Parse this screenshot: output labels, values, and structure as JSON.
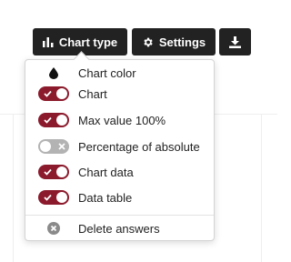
{
  "toolbar": {
    "chart_type_label": "Chart type",
    "chart_type_icon": "bar-chart-icon",
    "settings_label": "Settings",
    "settings_icon": "gear-icon",
    "download_icon": "download-icon",
    "button_color": "#222222"
  },
  "menu": {
    "items": [
      {
        "label": "Chart color",
        "icon": "color-drop-icon"
      },
      {
        "label": "Chart",
        "toggle": "on"
      },
      {
        "label": "Max value 100%",
        "toggle": "on"
      },
      {
        "label": "Percentage of absolute",
        "toggle": "off"
      },
      {
        "label": "Chart data",
        "toggle": "on"
      },
      {
        "label": "Data table",
        "toggle": "on"
      },
      {
        "label": "Delete answers",
        "icon": "delete-circle-icon"
      }
    ],
    "toggle_on_color": "#8b1a2c",
    "toggle_off_color": "#b3b3b3"
  }
}
